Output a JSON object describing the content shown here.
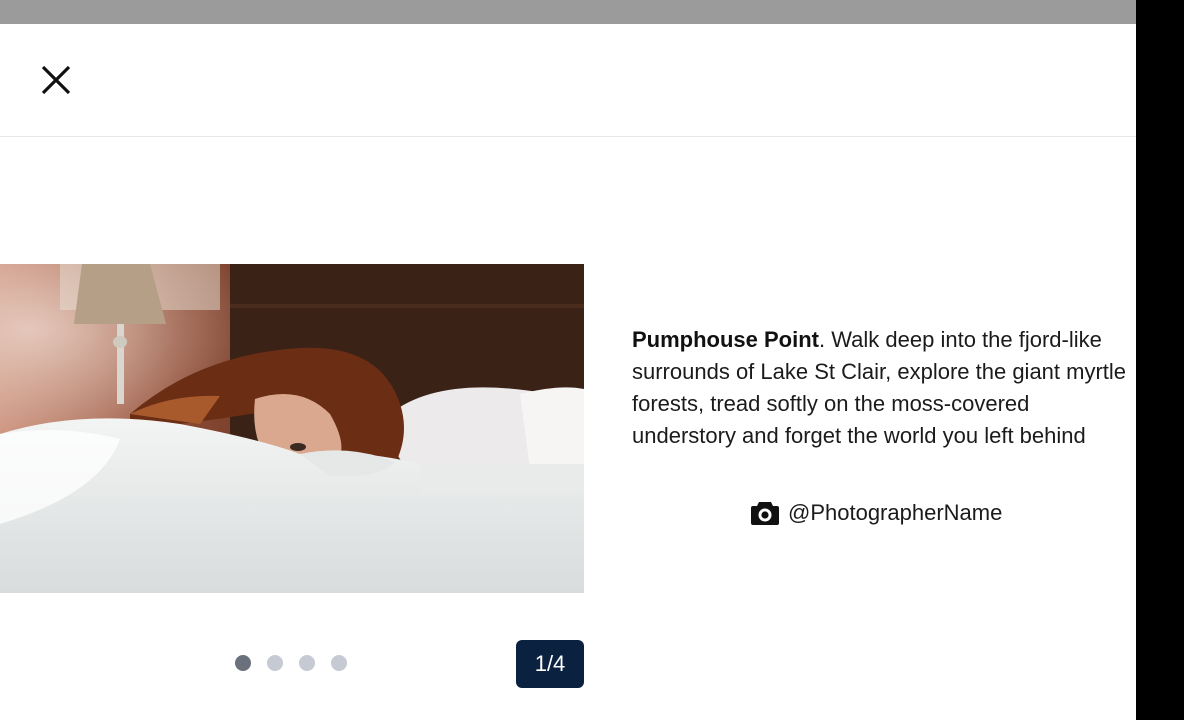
{
  "modal": {
    "close_icon": "close-icon"
  },
  "slide": {
    "image_icon": "photo-bed-woman",
    "caption_title": "Pumphouse Point",
    "caption_body": ". Walk deep into the fjord-like surrounds of Lake St Clair, explore the giant myrtle forests, tread softly on the moss-covered understory and forget the world you left behind",
    "credit_icon": "camera-icon",
    "credit_handle": "@PhotographerName"
  },
  "pagination": {
    "total": 4,
    "active_index": 0,
    "counter_text": "1/4"
  },
  "colors": {
    "top_strip": "#9b9b9b",
    "counter_bg": "#0b2140",
    "dot_active": "#6a707c",
    "dot_inactive": "#c5cad3"
  }
}
